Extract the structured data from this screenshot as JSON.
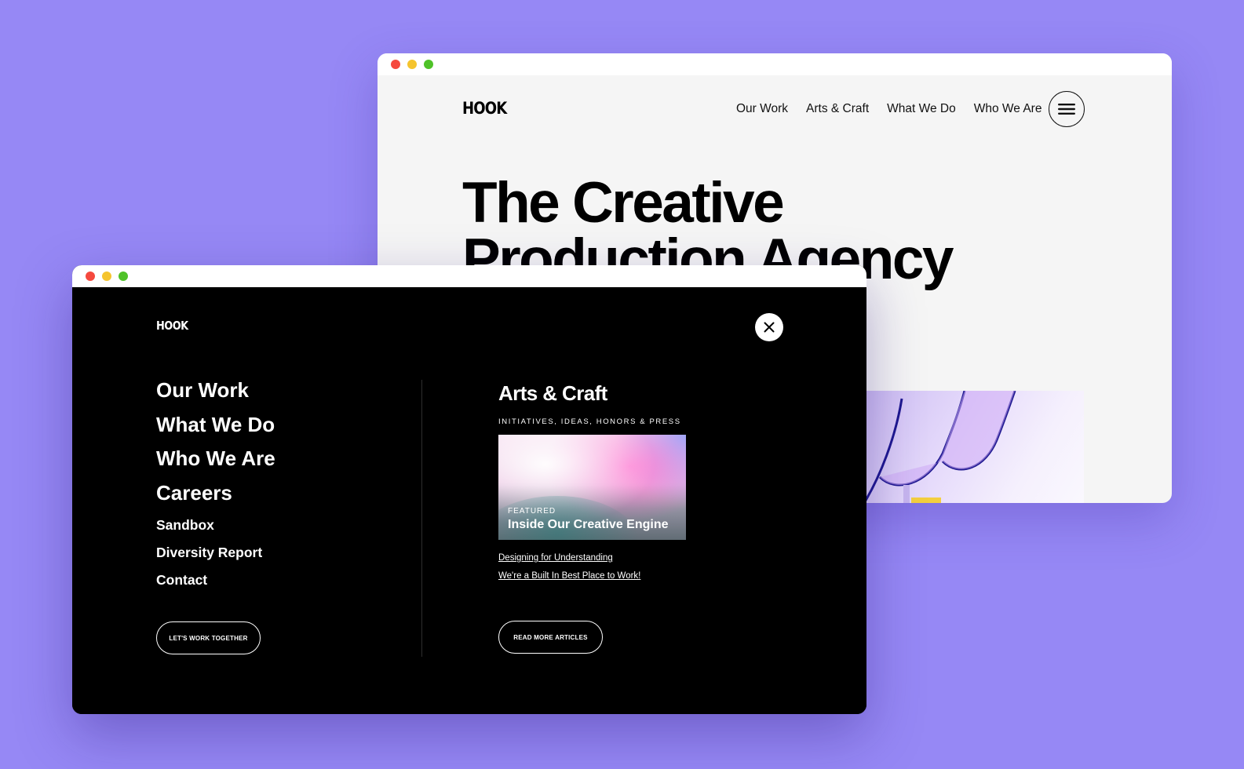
{
  "colors": {
    "background": "#9688f5",
    "traffic_red": "#f5493e",
    "traffic_yellow": "#f5c42e",
    "traffic_green": "#4fc228",
    "menu_bg": "#000000",
    "hero_bg": "#f5f5f5"
  },
  "back_window": {
    "logo": "HOOK",
    "nav": [
      "Our Work",
      "Arts & Craft",
      "What We Do",
      "Who We Are"
    ],
    "menu_icon": "hamburger-icon",
    "hero_line1": "The Creative",
    "hero_line2": "Production Agency"
  },
  "front_window": {
    "logo": "HOOK",
    "close_icon": "close-icon",
    "primary_nav": [
      "Our Work",
      "What We Do",
      "Who We Are",
      "Careers"
    ],
    "secondary_nav": [
      "Sandbox",
      "Diversity Report",
      "Contact"
    ],
    "cta_label": "LET'S WORK TOGETHER",
    "arts": {
      "heading": "Arts & Craft",
      "subheading": "INITIATIVES, IDEAS, HONORS & PRESS",
      "featured_label": "FEATURED",
      "featured_title": "Inside Our Creative Engine",
      "links": [
        "Designing for Understanding",
        "We're a Built In Best Place to Work!"
      ],
      "read_more_label": "READ MORE ARTICLES"
    }
  }
}
